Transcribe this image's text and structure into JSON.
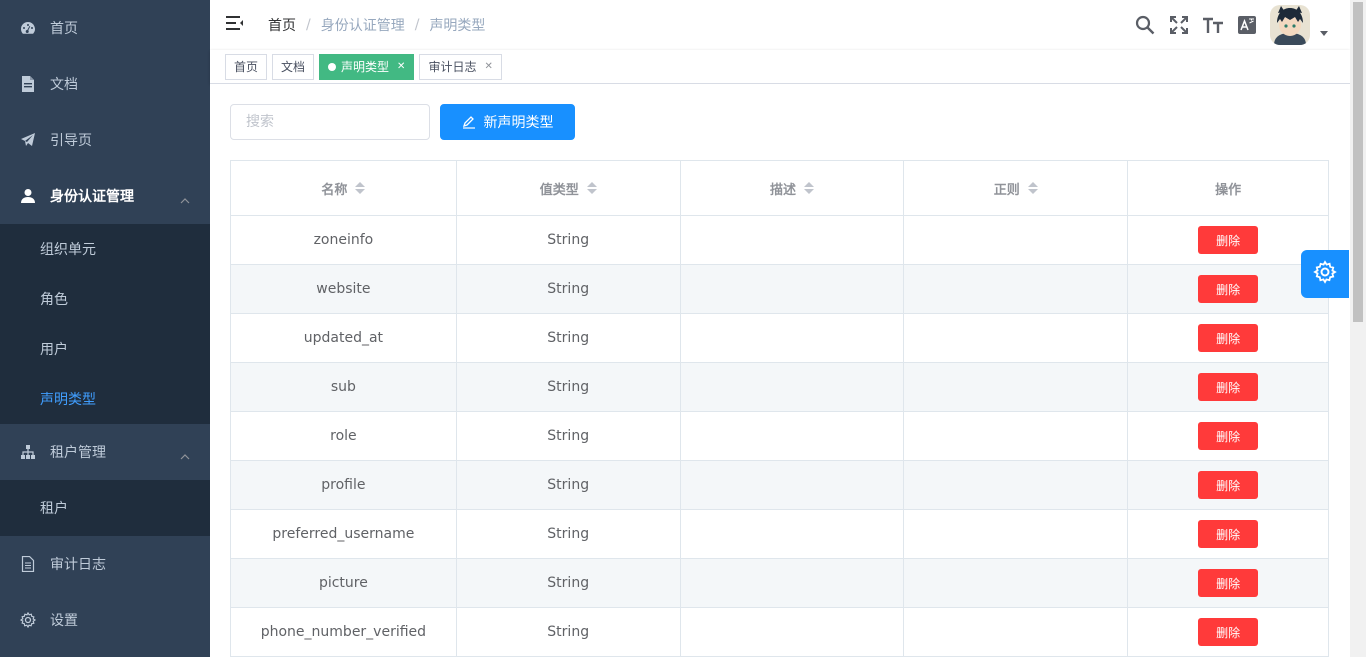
{
  "sidebar": {
    "items": [
      {
        "label": "首页",
        "icon": "dashboard-icon"
      },
      {
        "label": "文档",
        "icon": "document-icon"
      },
      {
        "label": "引导页",
        "icon": "paper-plane-icon"
      },
      {
        "label": "身份认证管理",
        "icon": "user-icon",
        "children": [
          "组织单元",
          "角色",
          "用户",
          "声明类型"
        ],
        "active_child": "声明类型"
      },
      {
        "label": "租户管理",
        "icon": "tree-icon",
        "children": [
          "租户"
        ]
      },
      {
        "label": "审计日志",
        "icon": "file-text-icon"
      },
      {
        "label": "设置",
        "icon": "gear-icon"
      }
    ]
  },
  "navbar": {
    "breadcrumb": [
      "首页",
      "身份认证管理",
      "声明类型"
    ],
    "icons": [
      "search-icon",
      "fullscreen-icon",
      "text-size-icon",
      "translate-icon"
    ]
  },
  "tags": [
    {
      "label": "首页",
      "active": false,
      "closable": false
    },
    {
      "label": "文档",
      "active": false,
      "closable": false
    },
    {
      "label": "声明类型",
      "active": true,
      "closable": true
    },
    {
      "label": "审计日志",
      "active": false,
      "closable": true
    }
  ],
  "filter": {
    "search_placeholder": "搜索",
    "new_button_label": "新声明类型"
  },
  "table": {
    "columns": [
      "名称",
      "值类型",
      "描述",
      "正则",
      "操作"
    ],
    "delete_label": "删除",
    "rows": [
      {
        "name": "zoneinfo",
        "value_type": "String",
        "description": "",
        "regex": ""
      },
      {
        "name": "website",
        "value_type": "String",
        "description": "",
        "regex": ""
      },
      {
        "name": "updated_at",
        "value_type": "String",
        "description": "",
        "regex": ""
      },
      {
        "name": "sub",
        "value_type": "String",
        "description": "",
        "regex": ""
      },
      {
        "name": "role",
        "value_type": "String",
        "description": "",
        "regex": ""
      },
      {
        "name": "profile",
        "value_type": "String",
        "description": "",
        "regex": ""
      },
      {
        "name": "preferred_username",
        "value_type": "String",
        "description": "",
        "regex": ""
      },
      {
        "name": "picture",
        "value_type": "String",
        "description": "",
        "regex": ""
      },
      {
        "name": "phone_number_verified",
        "value_type": "String",
        "description": "",
        "regex": ""
      }
    ]
  },
  "colors": {
    "sidebar_bg": "#304156",
    "submenu_bg": "#1f2d3d",
    "primary": "#1890ff",
    "active_tag": "#42b983",
    "danger": "#ff3a3a"
  }
}
